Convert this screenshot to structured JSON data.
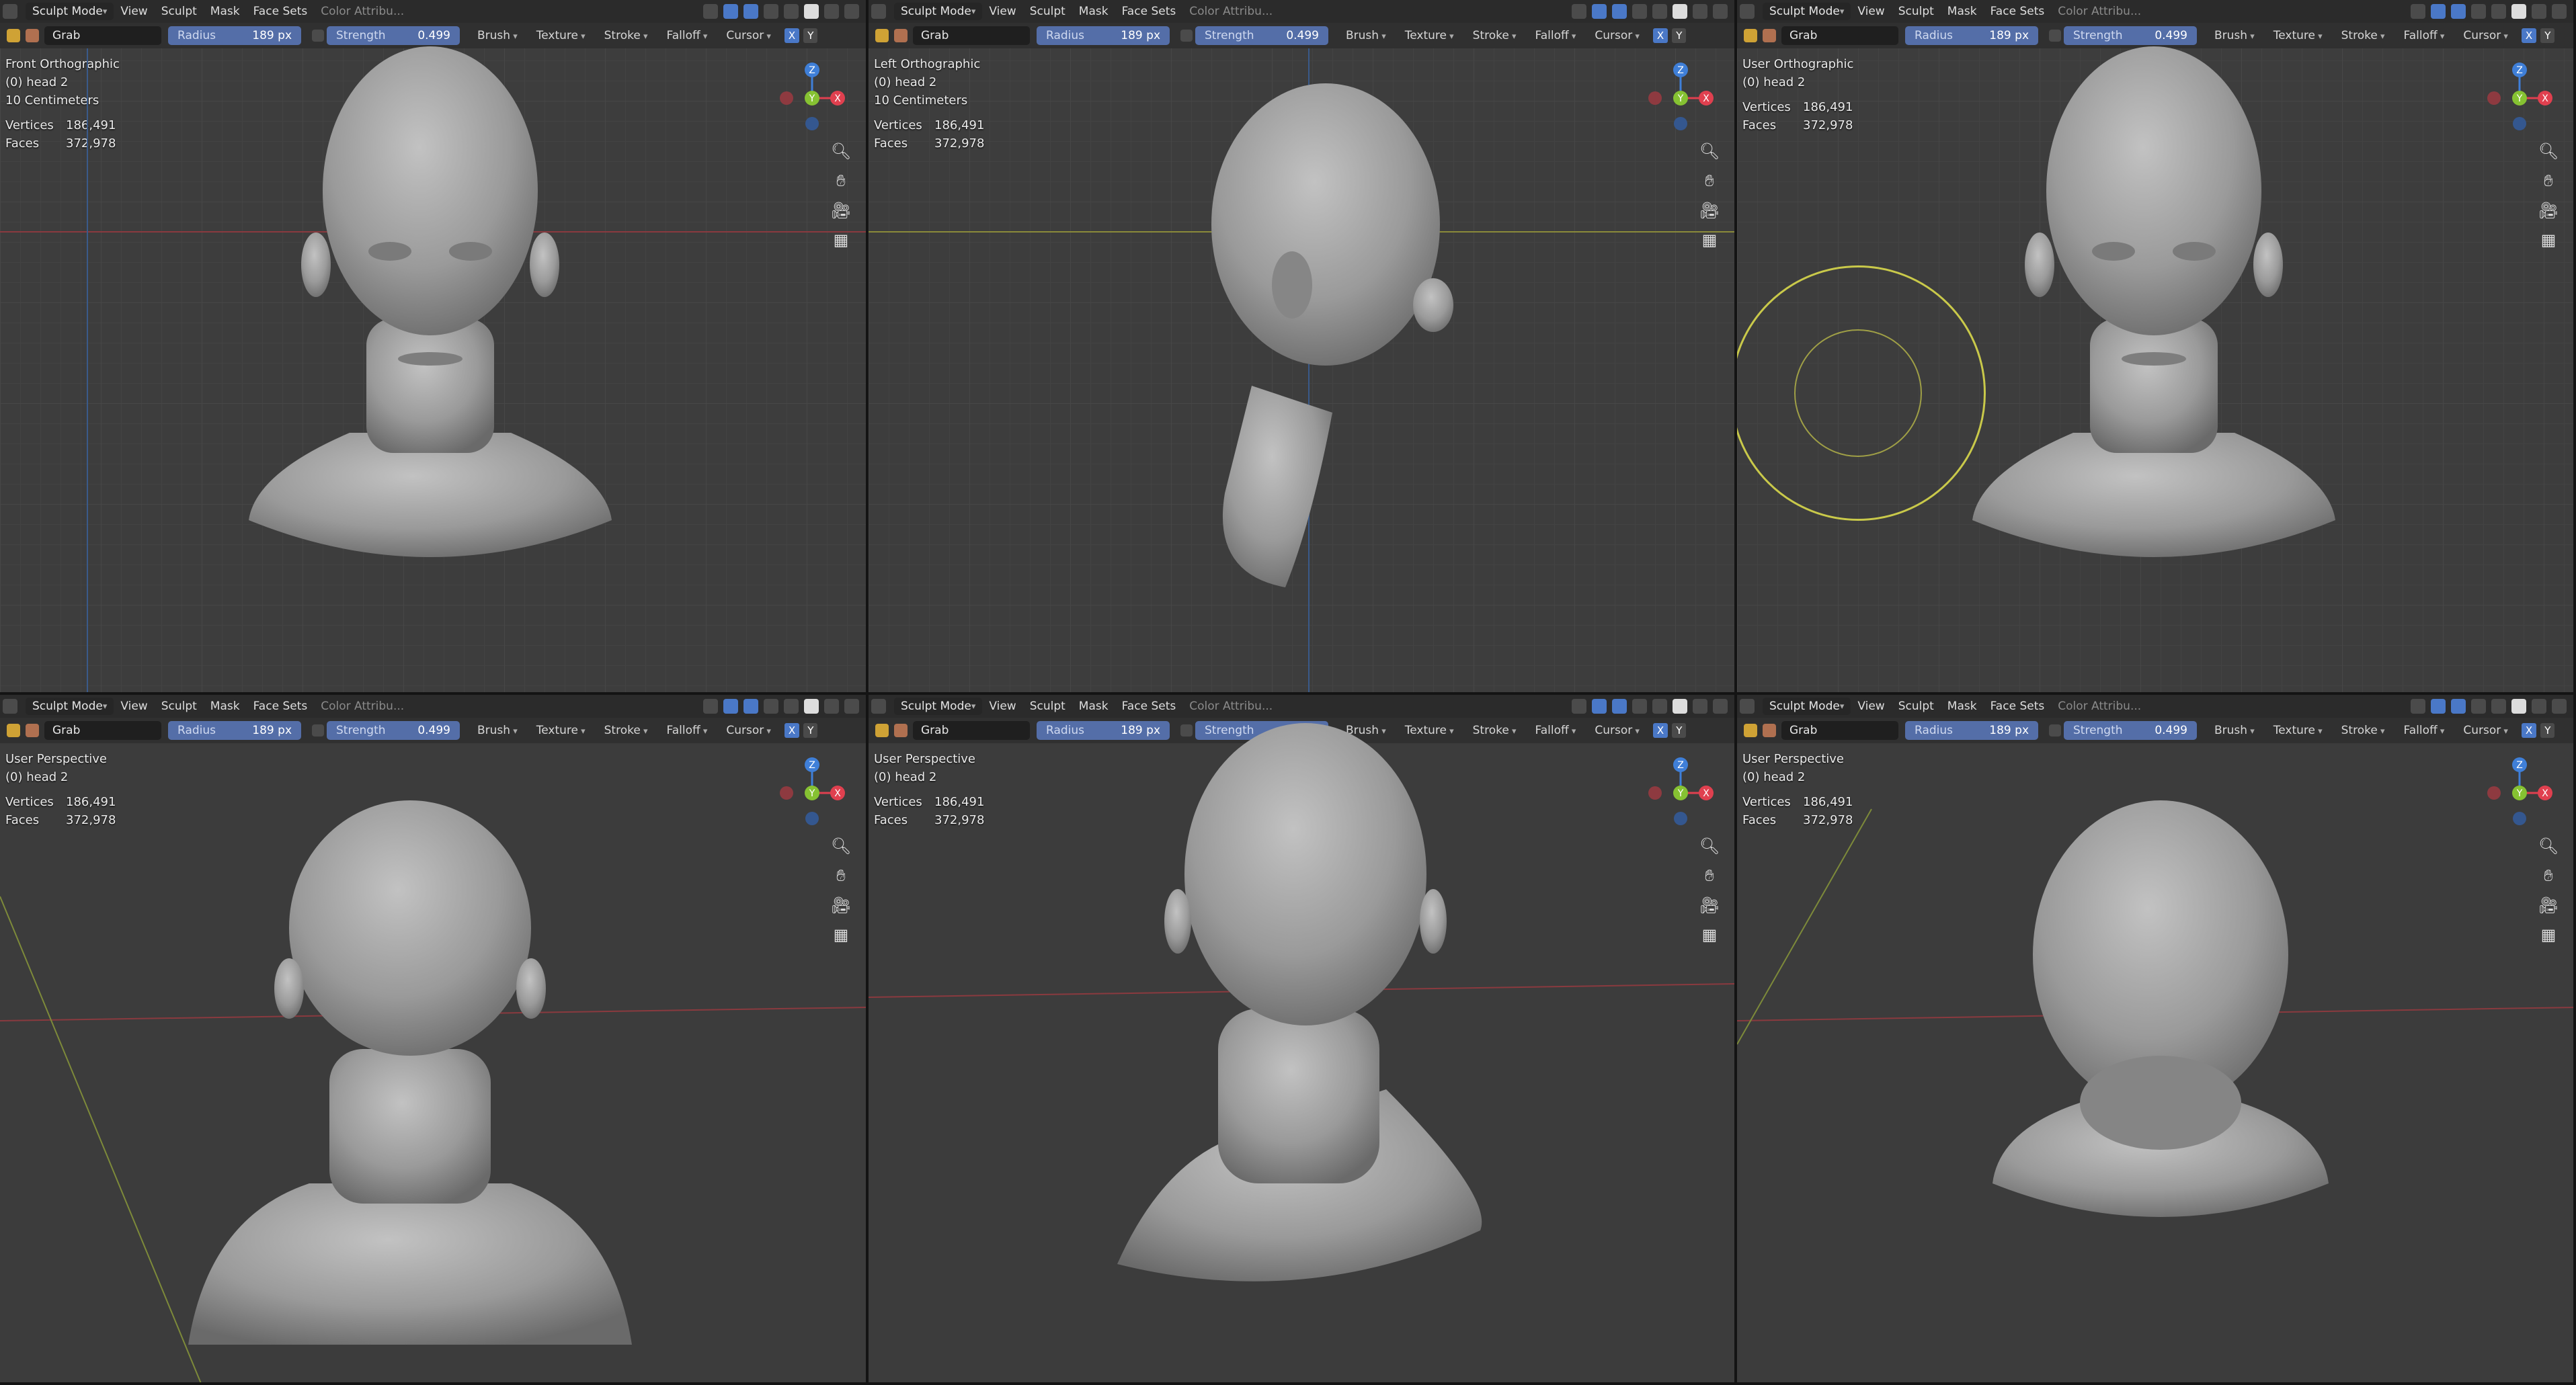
{
  "header": {
    "mode_label": "Sculpt Mode",
    "menus": [
      "View",
      "Sculpt",
      "Mask",
      "Face Sets"
    ],
    "color_attr": "Color Attribu...",
    "brush_name": "Grab",
    "radius_label": "Radius",
    "radius_value": "189 px",
    "strength_label": "Strength",
    "strength_value": "0.499",
    "dropdowns": [
      "Brush",
      "Texture",
      "Stroke",
      "Falloff",
      "Cursor"
    ],
    "axis_x": "X",
    "axis_y": "Y"
  },
  "stats": {
    "vertices_label": "Vertices",
    "vertices_value": "186,491",
    "faces_label": "Faces",
    "faces_value": "372,978"
  },
  "viewports": [
    {
      "view_name": "Front Orthographic",
      "object": "(0) head 2",
      "scale": "10 Centimeters"
    },
    {
      "view_name": "Left Orthographic",
      "object": "(0) head 2",
      "scale": "10 Centimeters"
    },
    {
      "view_name": "User Orthographic",
      "object": "(0) head 2",
      "scale": ""
    },
    {
      "view_name": "User Perspective",
      "object": "(0) head 2",
      "scale": ""
    },
    {
      "view_name": "User Perspective",
      "object": "(0) head 2",
      "scale": ""
    },
    {
      "view_name": "User Perspective",
      "object": "(0) head 2",
      "scale": ""
    }
  ],
  "gizmo_labels": {
    "x": "X",
    "y": "Y",
    "z": "Z"
  },
  "colors": {
    "x_axis": "#e0404f",
    "y_axis": "#86c232",
    "z_axis": "#3f7fd8",
    "header_bg": "#2b2b2b",
    "viewport_bg": "#3c3c3c",
    "model": "#9a9a9a",
    "field": "#546ea8"
  }
}
